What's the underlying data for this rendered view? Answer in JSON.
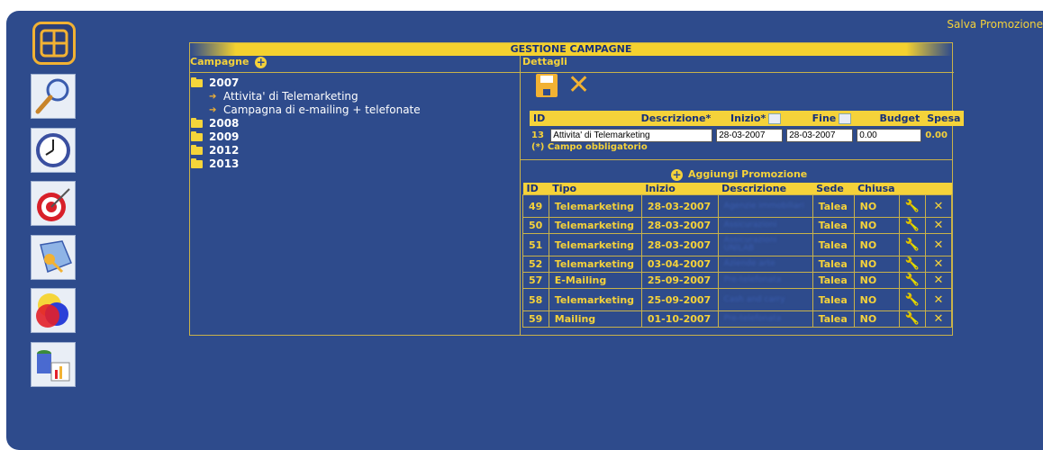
{
  "header": {
    "salva_label": "Salva Promozione"
  },
  "panel": {
    "title": "GESTIONE CAMPAGNE",
    "campagne_label": "Campagne",
    "dettagli_label": "Dettagli"
  },
  "tree": {
    "years": [
      {
        "label": "2007",
        "open": true,
        "children": [
          "Attivita' di Telemarketing",
          "Campagna di e-mailing + telefonate"
        ]
      },
      {
        "label": "2008"
      },
      {
        "label": "2009"
      },
      {
        "label": "2012"
      },
      {
        "label": "2013"
      }
    ]
  },
  "detail": {
    "headers": {
      "id": "ID",
      "descrizione": "Descrizione*",
      "inizio": "Inizio*",
      "fine": "Fine",
      "budget": "Budget",
      "spesa": "Spesa"
    },
    "values": {
      "id": "13",
      "descrizione": "Attivita' di Telemarketing",
      "inizio": "28-03-2007",
      "fine": "28-03-2007",
      "budget": "0.00",
      "spesa": "0.00"
    },
    "required_note": "(*) Campo obbligatorio"
  },
  "promo": {
    "add_label": "Aggiungi Promozione",
    "headers": {
      "id": "ID",
      "tipo": "Tipo",
      "inizio": "Inizio",
      "descrizione": "Descrizione",
      "sede": "Sede",
      "chiusa": "Chiusa"
    },
    "rows": [
      {
        "id": "49",
        "tipo": "Telemarketing",
        "inizio": "28-03-2007",
        "descrizione": "Agenzie immobiliari",
        "sede": "Talea",
        "chiusa": "NO"
      },
      {
        "id": "50",
        "tipo": "Telemarketing",
        "inizio": "28-03-2007",
        "descrizione": "Assicurazioni",
        "sede": "Talea",
        "chiusa": "NO"
      },
      {
        "id": "51",
        "tipo": "Telemarketing",
        "inizio": "28-03-2007",
        "descrizione": "Assicurazioni UNILAB",
        "sede": "Talea",
        "chiusa": "NO"
      },
      {
        "id": "52",
        "tipo": "Telemarketing",
        "inizio": "03-04-2007",
        "descrizione": "Aziende arte",
        "sede": "Talea",
        "chiusa": "NO"
      },
      {
        "id": "57",
        "tipo": "E-Mailing",
        "inizio": "25-09-2007",
        "descrizione": "Pre-telefonata",
        "sede": "Talea",
        "chiusa": "NO"
      },
      {
        "id": "58",
        "tipo": "Telemarketing",
        "inizio": "25-09-2007",
        "descrizione": "Cash and carry",
        "sede": "Talea",
        "chiusa": "NO"
      },
      {
        "id": "59",
        "tipo": "Mailing",
        "inizio": "01-10-2007",
        "descrizione": "Pre-telefonata",
        "sede": "Talea",
        "chiusa": "NO"
      }
    ]
  },
  "icons": {
    "wrench": "wrench-icon",
    "delete": "delete-x-icon"
  }
}
